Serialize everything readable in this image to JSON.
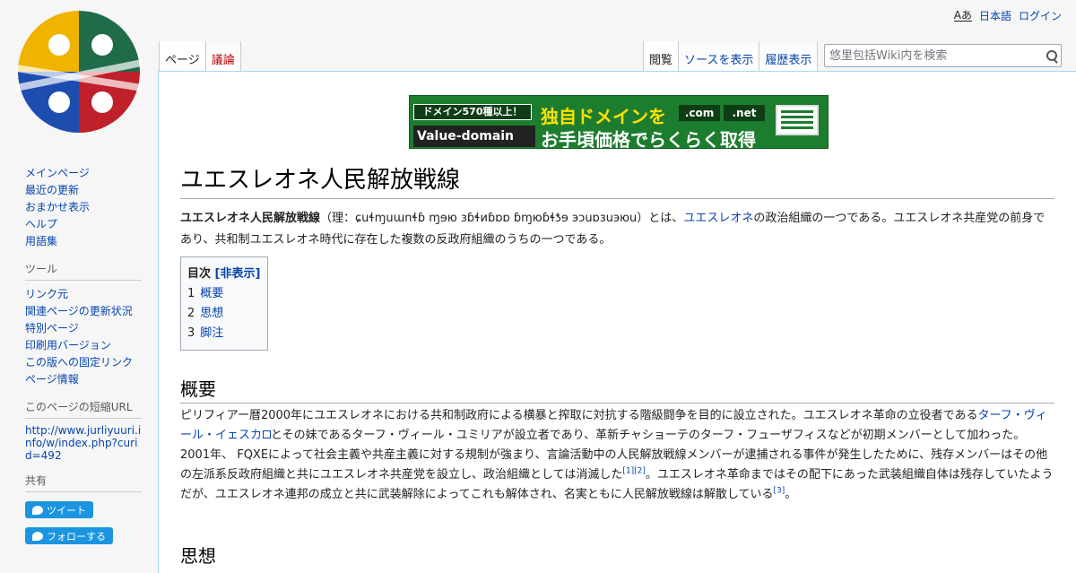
{
  "site": {
    "logo_icon": "birds-logo-icon"
  },
  "personal": {
    "lang_icon": "Aあ",
    "language": "日本語",
    "login": "ログイン"
  },
  "tabs": {
    "left": [
      {
        "label": "ページ",
        "state": "selected"
      },
      {
        "label": "議論",
        "state": "new"
      }
    ],
    "right": [
      {
        "label": "閲覧",
        "state": "selected"
      },
      {
        "label": "ソースを表示",
        "state": "link"
      },
      {
        "label": "履歴表示",
        "state": "link"
      }
    ]
  },
  "search": {
    "placeholder": "悠里包括Wiki内を検索",
    "value": ""
  },
  "sidebar": {
    "nav": [
      "メインページ",
      "最近の更新",
      "おまかせ表示",
      "ヘルプ",
      "用語集"
    ],
    "tools_heading": "ツール",
    "tools": [
      "リンク元",
      "関連ページの更新状況",
      "特別ページ",
      "印刷用バージョン",
      "この版への固定リンク",
      "ページ情報"
    ],
    "shorturl_heading": "このページの短縮URL",
    "shorturl": "http://www.jurliyuuri.info/w/index.php?curid=492",
    "share_heading": "共有",
    "tweet_label": "ツイート",
    "follow_label": "フォローする"
  },
  "banner": {
    "badge": "ドメイン570種以上！",
    "brand": "Value-domain",
    "headline": "独自ドメインを",
    "subline": "お手頃価格でらくらく取得",
    "tld1": ".com",
    "tld2": ".net"
  },
  "page": {
    "title": "ユエスレオネ人民解放戦線",
    "intro_bold": "ユエスレオネ人民解放戦線",
    "intro_native": "（理：ɕuɬɱuɯnɬɓ ɱɘю зɓɬиɓɒɒ ɓɱюɓɬƾɘ эɔuɒɜuэюu）",
    "intro_mid": "とは、",
    "intro_link": "ユエスレオネ",
    "intro_rest": "の政治組織の一つである。ユエスレオネ共産党の前身であり、共和制ユエスレオネ時代に存在した複数の反政府組織のうちの一つである。",
    "toc": {
      "title": "目次",
      "toggle": "[非表示]",
      "items": [
        {
          "num": "1",
          "label": "概要"
        },
        {
          "num": "2",
          "label": "思想"
        },
        {
          "num": "3",
          "label": "脚注"
        }
      ]
    },
    "section1": "概要",
    "para_a": "ピリフィアー暦2000年にユエスレオネにおける共和制政府による横暴と搾取に対抗する階級闘争を目的に設立された。ユエスレオネ革命の立役者である",
    "para_link": "ターフ・ヴィール・イェスカ",
    "para_b": "とその妹であるターフ・ヴィール・ユミリアが設立者であり、革新チャショーテのターフ・フューザフィスなどが初期メンバーとして加わった。2001年、 FQXEによって社会主義や共産主義に対する規制が強まり、言論活動中の人民解放戦線メンバーが逮捕される事件が発生したために、残存メンバーはその他の左派系反政府組織と共にユエスレオネ共産党を設立し、政治組織としては消滅した",
    "ref1": "[1]",
    "ref2": "[2]",
    "para_c": "。ユエスレオネ革命まではその配下にあった武装組織自体は残存していたようだが、ユエスレオネ連邦の成立と共に武装解除によってこれも解体され、名実ともに人民解放戦線は解散している",
    "ref3": "[3]",
    "para_d": "。",
    "section2": "思想"
  }
}
